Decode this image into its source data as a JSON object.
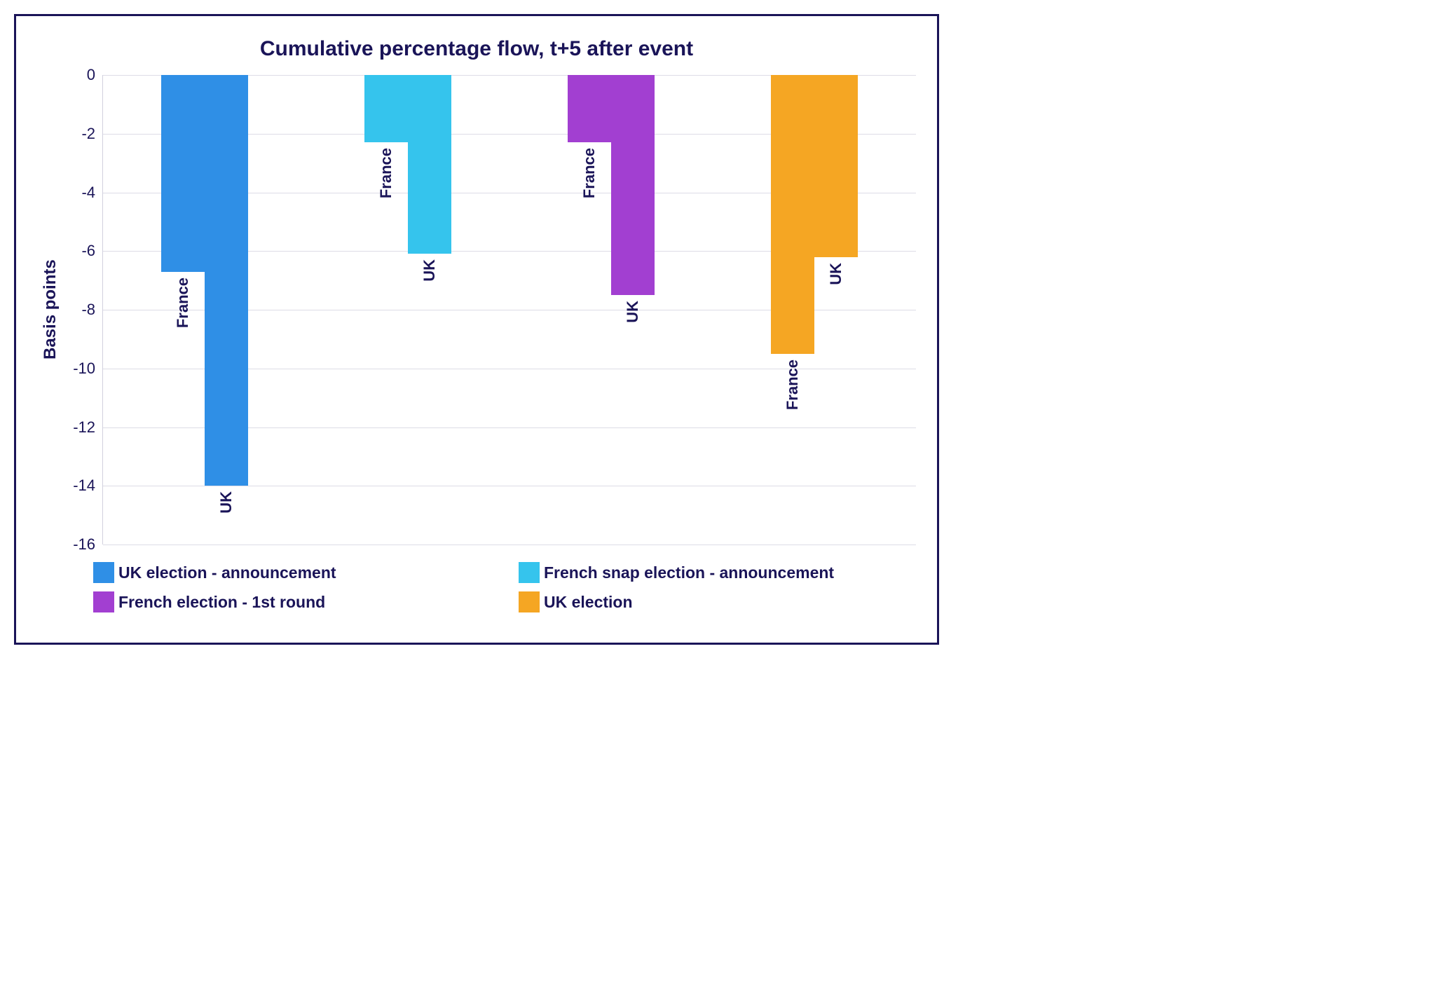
{
  "chart_data": {
    "type": "bar",
    "title": "Cumulative percentage flow, t+5 after event",
    "ylabel": "Basis points",
    "ylim": [
      -16,
      0
    ],
    "yticks": [
      0,
      -2,
      -4,
      -6,
      -8,
      -10,
      -12,
      -14,
      -16
    ],
    "categories": [
      "France",
      "UK"
    ],
    "series": [
      {
        "name": "UK election - announcement",
        "color": "#2f8fe6",
        "values": [
          -6.7,
          -14.0
        ]
      },
      {
        "name": "French snap election - announcement",
        "color": "#35c4ed",
        "values": [
          -2.3,
          -6.1
        ]
      },
      {
        "name": "French election - 1st round",
        "color": "#a23fd1",
        "values": [
          -2.3,
          -7.5
        ]
      },
      {
        "name": "UK election",
        "color": "#f5a623",
        "values": [
          -9.5,
          -6.2
        ]
      }
    ]
  }
}
